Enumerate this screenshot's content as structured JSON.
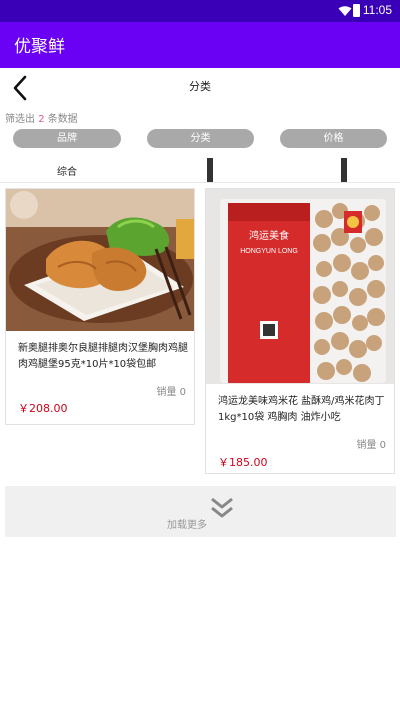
{
  "status_bar": {
    "time": "11:05"
  },
  "app_bar": {
    "title": "优聚鲜"
  },
  "nav": {
    "title": "分类"
  },
  "filter": {
    "prefix": "筛选出",
    "count": "2",
    "suffix": "条数据"
  },
  "filter_pills": {
    "brand": "品牌",
    "category": "分类",
    "price": "价格"
  },
  "sort": {
    "label": "综合"
  },
  "products": [
    {
      "name": "新奥腿排奥尔良腿排腿肉汉堡胸肉鸡腿肉鸡腿堡95克*10片*10袋包邮",
      "sales": "销量 0",
      "price": "￥208.00",
      "image_icon": "fried-chicken-image"
    },
    {
      "name": "鸿运龙美味鸡米花 盐酥鸡/鸡米花肉丁1kg*10袋 鸡胸肉 油炸小吃",
      "sales": "销量 0",
      "price": "￥185.00",
      "image_icon": "packaged-popcorn-chicken-image",
      "package_label": "鸿运美食",
      "package_brand": "HONGYUN LONG"
    }
  ],
  "load_more": {
    "label": "加载更多"
  },
  "colors": {
    "status_bar": "#3a00b8",
    "app_bar": "#6a00f4",
    "price": "#d0021b",
    "pill": "#a9a9a9"
  }
}
